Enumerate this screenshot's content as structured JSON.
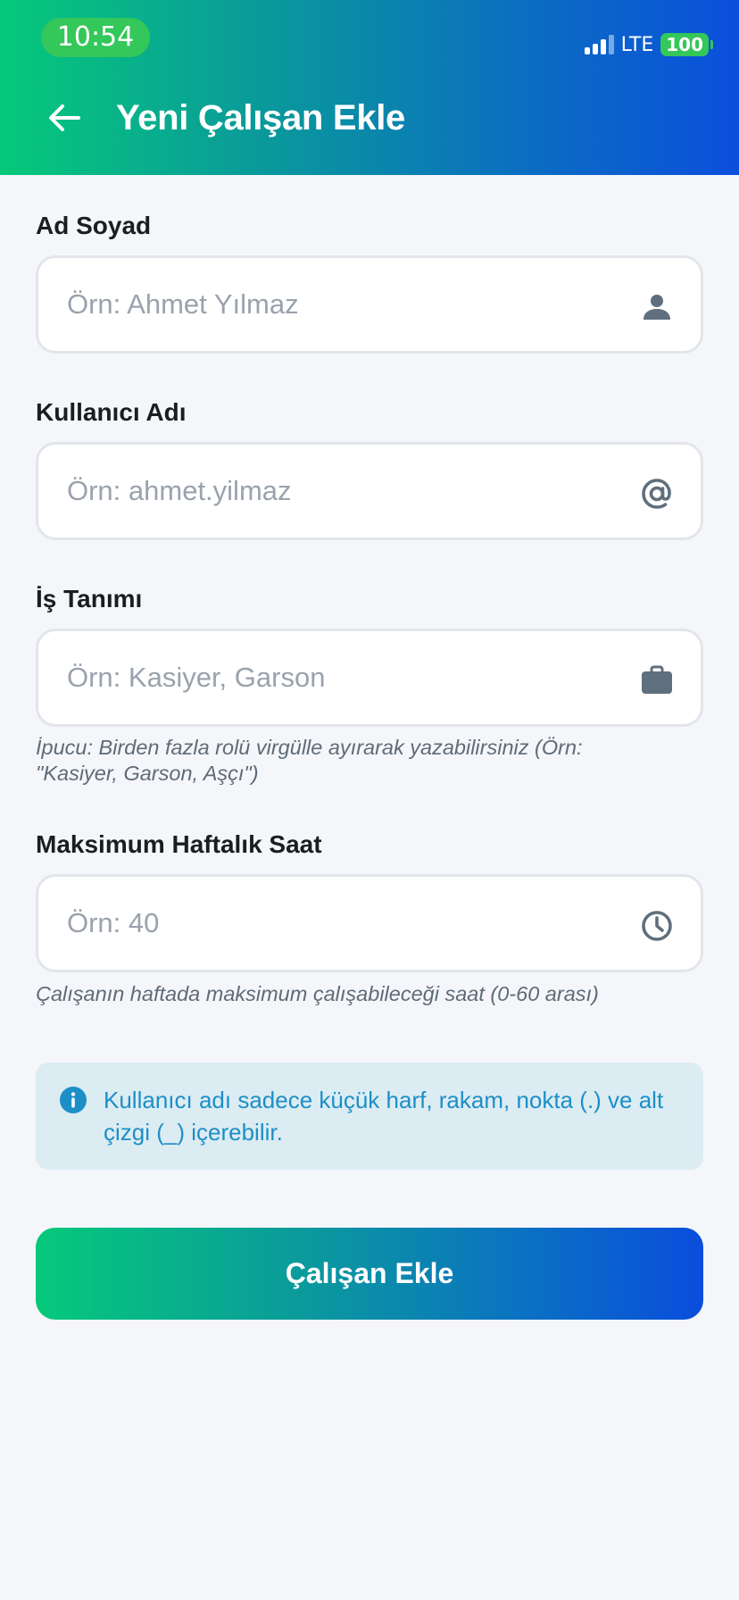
{
  "status_bar": {
    "time": "10:54",
    "network": "LTE",
    "battery": "100"
  },
  "header": {
    "title": "Yeni Çalışan Ekle",
    "back_icon": "arrow-left-icon"
  },
  "form": {
    "full_name": {
      "label": "Ad Soyad",
      "placeholder": "Örn: Ahmet Yılmaz",
      "value": "",
      "icon": "person-icon"
    },
    "username": {
      "label": "Kullanıcı Adı",
      "placeholder": "Örn: ahmet.yilmaz",
      "value": "",
      "icon": "at-icon"
    },
    "job_title": {
      "label": "İş Tanımı",
      "placeholder": "Örn: Kasiyer, Garson",
      "value": "",
      "icon": "briefcase-icon",
      "hint": "İpucu: Birden fazla rolü virgülle ayırarak yazabilirsiniz (Örn: \"Kasiyer, Garson, Aşçı\")"
    },
    "max_weekly_hours": {
      "label": "Maksimum Haftalık Saat",
      "placeholder": "Örn: 40",
      "value": "",
      "icon": "clock-icon",
      "hint": "Çalışanın haftada maksimum çalışabileceği saat (0-60 arası)"
    }
  },
  "info": {
    "icon": "info-icon",
    "text": "Kullanıcı adı sadece küçük harf, rakam, nokta (.) ve alt çizgi (_) içerebilir."
  },
  "submit": {
    "label": "Çalışan Ekle"
  },
  "colors": {
    "gradient_start": "#06c97a",
    "gradient_end": "#0b4fdd",
    "icon_gray": "#5f6f7d",
    "info_text": "#1d8fc7",
    "info_bg": "#dcecf3"
  }
}
